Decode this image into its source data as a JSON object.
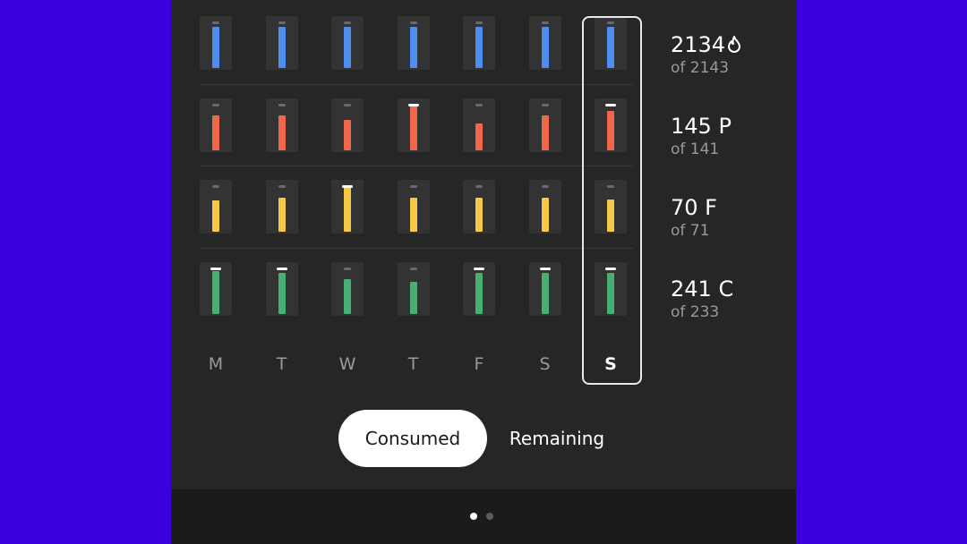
{
  "colors": {
    "background": "#3a00e0",
    "panel": "#262626",
    "calories": "#4f8ef0",
    "protein": "#f0684a",
    "fat": "#f5c84a",
    "carbs": "#46b073"
  },
  "days": [
    "M",
    "T",
    "W",
    "T",
    "F",
    "S",
    "S"
  ],
  "selected_day_index": 6,
  "rows": [
    {
      "key": "calories",
      "value": "2134",
      "sub": "of 2143",
      "icon": "flame-icon",
      "levels": [
        0.95,
        0.95,
        0.95,
        0.95,
        0.95,
        0.95,
        0.95
      ]
    },
    {
      "key": "protein",
      "value": "145 P",
      "sub": "of 141",
      "levels": [
        0.8,
        0.8,
        0.7,
        1.05,
        0.62,
        0.8,
        0.9
      ]
    },
    {
      "key": "fat",
      "value": "70 F",
      "sub": "of 71",
      "levels": [
        0.72,
        0.8,
        1.1,
        0.8,
        0.8,
        0.8,
        0.75
      ]
    },
    {
      "key": "carbs",
      "value": "241 C",
      "sub": "of 233",
      "levels": [
        0.98,
        0.95,
        0.8,
        0.75,
        0.95,
        0.95,
        0.95
      ]
    }
  ],
  "toggle": {
    "consumed_label": "Consumed",
    "remaining_label": "Remaining",
    "active": "consumed"
  },
  "pager": {
    "pages": 2,
    "active": 0
  }
}
